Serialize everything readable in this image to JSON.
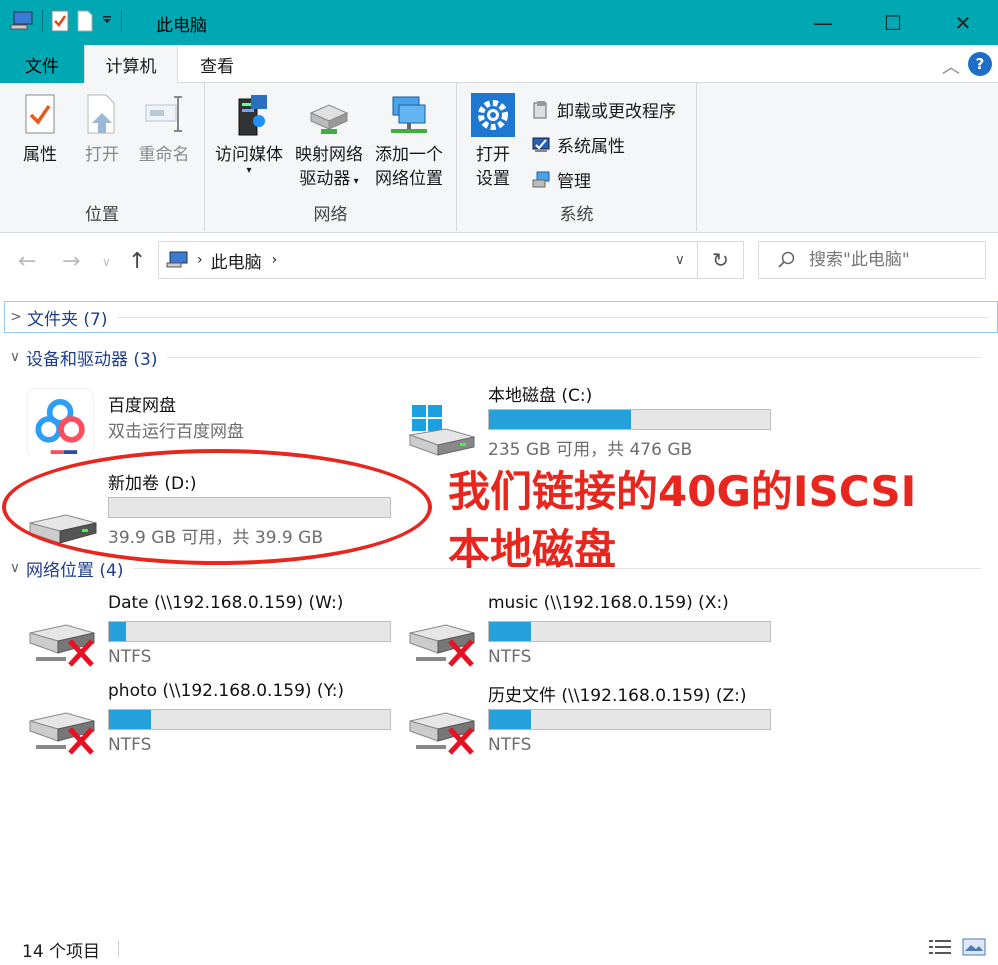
{
  "window": {
    "title": "此电脑",
    "minimize_glyph": "—",
    "maximize_glyph": "☐",
    "close_glyph": "✕"
  },
  "tabs": {
    "file": "文件",
    "computer": "计算机",
    "view": "查看",
    "help_glyph": "?",
    "collapse_glyph": "︿"
  },
  "ribbon": {
    "location": {
      "label": "位置",
      "properties": "属性",
      "open": "打开",
      "rename": "重命名"
    },
    "network": {
      "label": "网络",
      "access_media": "访问媒体",
      "map_drive_line1": "映射网络",
      "map_drive_line2": "驱动器",
      "add_location_line1": "添加一个",
      "add_location_line2": "网络位置"
    },
    "system": {
      "label": "系统",
      "open_settings_line1": "打开",
      "open_settings_line2": "设置",
      "uninstall": "卸载或更改程序",
      "sys_props": "系统属性",
      "manage": "管理"
    }
  },
  "address": {
    "crumb": "此电脑",
    "search_placeholder": "搜索\"此电脑\""
  },
  "sections": {
    "folders": "文件夹 (7)",
    "devices": "设备和驱动器 (3)",
    "network": "网络位置 (4)"
  },
  "devices": [
    {
      "name": "百度网盘",
      "sub": "双击运行百度网盘",
      "icon": "baidu-netdisk-icon"
    },
    {
      "name": "本地磁盘 (C:)",
      "sub": "235 GB 可用，共 476 GB",
      "used_fraction": 0.506,
      "icon": "windows-drive-icon"
    },
    {
      "name": "新加卷 (D:)",
      "sub": "39.9 GB 可用，共 39.9 GB",
      "used_fraction": 0.0,
      "icon": "drive-icon"
    }
  ],
  "network_drives": [
    {
      "name": "Date (\\\\192.168.0.159) (W:)",
      "sub": "NTFS",
      "used_fraction": 0.06
    },
    {
      "name": "music (\\\\192.168.0.159) (X:)",
      "sub": "NTFS",
      "used_fraction": 0.15
    },
    {
      "name": "photo (\\\\192.168.0.159) (Y:)",
      "sub": "NTFS",
      "used_fraction": 0.15
    },
    {
      "name": "历史文件 (\\\\192.168.0.159) (Z:)",
      "sub": "NTFS",
      "used_fraction": 0.15
    }
  ],
  "annotation": {
    "line1": "我们链接的40G的ISCSI",
    "line2": "本地磁盘"
  },
  "status": {
    "count": "14 个项目"
  },
  "colors": {
    "accent": "#00a8b4",
    "bar_fill": "#26a0da",
    "annotation": "#e8261e"
  }
}
